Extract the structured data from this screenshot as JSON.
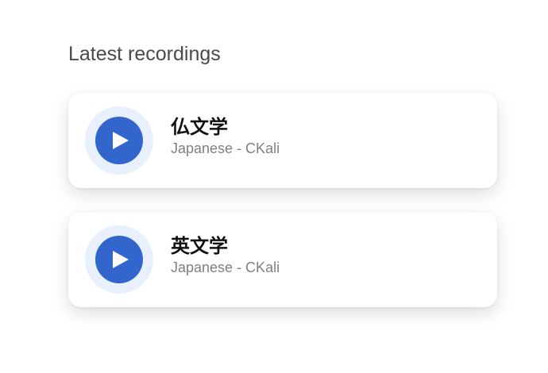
{
  "page": {
    "section_title": "Latest recordings"
  },
  "recordings": [
    {
      "title": "仏文学",
      "subtitle": "Japanese - CKali",
      "icon": "play-icon"
    },
    {
      "title": "英文学",
      "subtitle": "Japanese - CKali",
      "icon": "play-icon"
    }
  ],
  "colors": {
    "accent": "#3366cc",
    "accent_halo": "#e8f0fd",
    "title_text": "#111111",
    "subtitle_text": "#808080",
    "heading_text": "#4a4a4a",
    "background": "#ffffff"
  }
}
